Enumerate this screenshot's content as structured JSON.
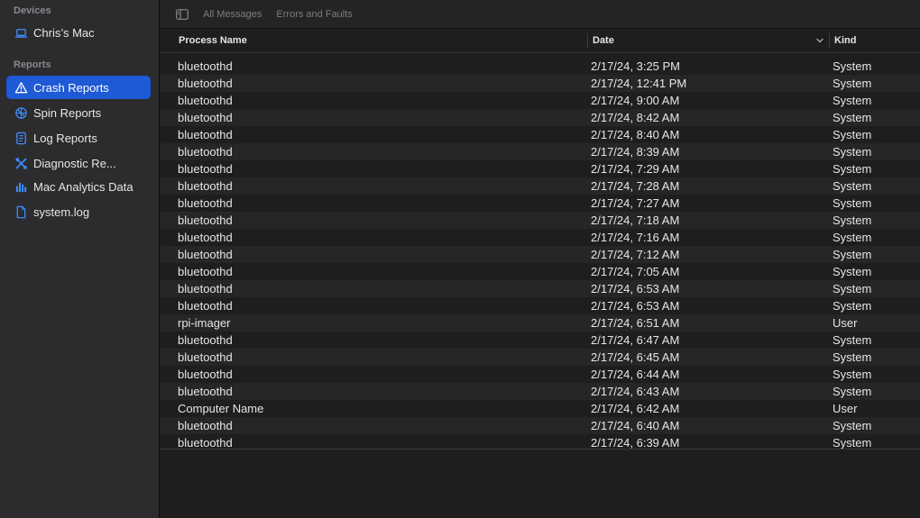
{
  "sidebar": {
    "devices_label": "Devices",
    "device_name": "Chris’s Mac",
    "reports_label": "Reports",
    "items": [
      {
        "label": "Crash Reports",
        "icon": "warning-icon"
      },
      {
        "label": "Spin Reports",
        "icon": "spin-icon"
      },
      {
        "label": "Log Reports",
        "icon": "log-document-icon"
      },
      {
        "label": "Diagnostic Re...",
        "icon": "tools-icon"
      },
      {
        "label": "Mac Analytics Data",
        "icon": "analytics-chart-icon"
      },
      {
        "label": "system.log",
        "icon": "file-icon"
      }
    ],
    "selected_index": 0
  },
  "toolbar": {
    "tabs": [
      "All Messages",
      "Errors and Faults"
    ]
  },
  "table": {
    "columns": [
      "Process Name",
      "Date",
      "Kind"
    ],
    "sort_column": "Date",
    "rows": [
      [
        "bluetoothd",
        "2/17/24, 3:25 PM",
        "System"
      ],
      [
        "bluetoothd",
        "2/17/24, 12:41 PM",
        "System"
      ],
      [
        "bluetoothd",
        "2/17/24, 9:00 AM",
        "System"
      ],
      [
        "bluetoothd",
        "2/17/24, 8:42 AM",
        "System"
      ],
      [
        "bluetoothd",
        "2/17/24, 8:40 AM",
        "System"
      ],
      [
        "bluetoothd",
        "2/17/24, 8:39 AM",
        "System"
      ],
      [
        "bluetoothd",
        "2/17/24, 7:29 AM",
        "System"
      ],
      [
        "bluetoothd",
        "2/17/24, 7:28 AM",
        "System"
      ],
      [
        "bluetoothd",
        "2/17/24, 7:27 AM",
        "System"
      ],
      [
        "bluetoothd",
        "2/17/24, 7:18 AM",
        "System"
      ],
      [
        "bluetoothd",
        "2/17/24, 7:16 AM",
        "System"
      ],
      [
        "bluetoothd",
        "2/17/24, 7:12 AM",
        "System"
      ],
      [
        "bluetoothd",
        "2/17/24, 7:05 AM",
        "System"
      ],
      [
        "bluetoothd",
        "2/17/24, 6:53 AM",
        "System"
      ],
      [
        "bluetoothd",
        "2/17/24, 6:53 AM",
        "System"
      ],
      [
        "rpi-imager",
        "2/17/24, 6:51 AM",
        "User"
      ],
      [
        "bluetoothd",
        "2/17/24, 6:47 AM",
        "System"
      ],
      [
        "bluetoothd",
        "2/17/24, 6:45 AM",
        "System"
      ],
      [
        "bluetoothd",
        "2/17/24, 6:44 AM",
        "System"
      ],
      [
        "bluetoothd",
        "2/17/24, 6:43 AM",
        "System"
      ],
      [
        "Computer Name",
        "2/17/24, 6:42 AM",
        "User"
      ],
      [
        "bluetoothd",
        "2/17/24, 6:40 AM",
        "System"
      ],
      [
        "bluetoothd",
        "2/17/24, 6:39 AM",
        "System"
      ]
    ]
  },
  "colors": {
    "accent": "#1e59d6",
    "icon_blue": "#3d8bff",
    "background": "#1e1e1e",
    "sidebar": "#2c2c2e"
  }
}
